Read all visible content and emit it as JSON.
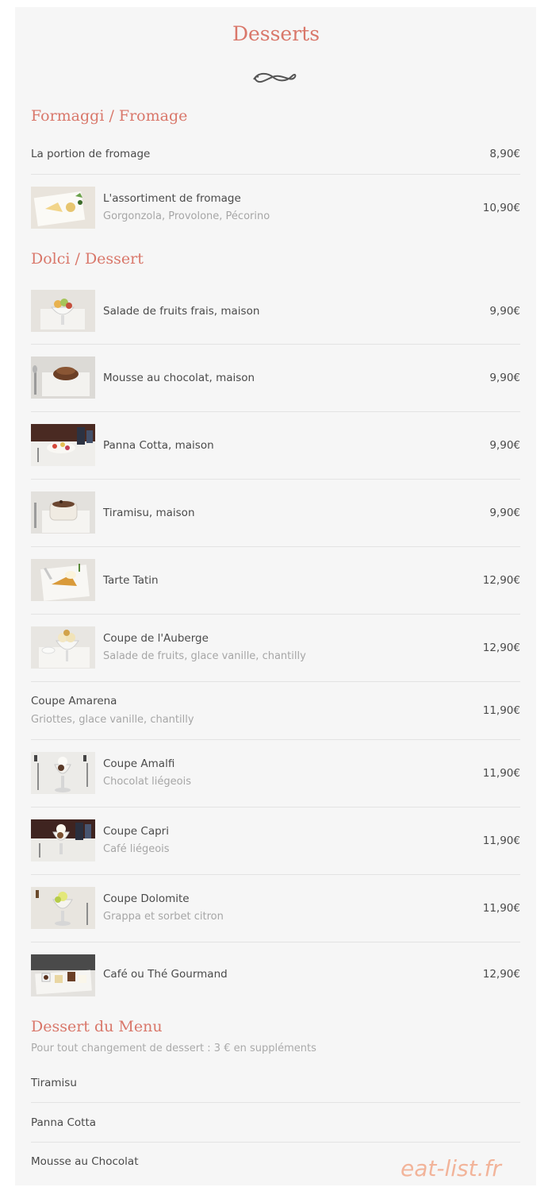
{
  "page": {
    "title": "Desserts"
  },
  "sections": {
    "fromage": {
      "title": "Formaggi / Fromage",
      "items": [
        {
          "name": "La portion de fromage",
          "price": "8,90€"
        },
        {
          "name": "L'assortiment de fromage",
          "desc": "Gorgonzola, Provolone, Pécorino",
          "price": "10,90€"
        }
      ]
    },
    "dessert": {
      "title": "Dolci / Dessert",
      "items": [
        {
          "name": "Salade de fruits frais, maison",
          "price": "9,90€"
        },
        {
          "name": "Mousse au chocolat, maison",
          "price": "9,90€"
        },
        {
          "name": "Panna Cotta, maison",
          "price": "9,90€"
        },
        {
          "name": "Tiramisu, maison",
          "price": "9,90€"
        },
        {
          "name": "Tarte Tatin",
          "price": "12,90€"
        },
        {
          "name": "Coupe de l'Auberge",
          "desc": "Salade de fruits, glace vanille, chantilly",
          "price": "12,90€"
        },
        {
          "name": "Coupe Amarena",
          "desc": "Griottes, glace vanille, chantilly",
          "price": "11,90€"
        },
        {
          "name": "Coupe Amalfi",
          "desc": "Chocolat liégeois",
          "price": "11,90€"
        },
        {
          "name": "Coupe Capri",
          "desc": "Café liégeois",
          "price": "11,90€"
        },
        {
          "name": "Coupe Dolomite",
          "desc": "Grappa et sorbet citron",
          "price": "11,90€"
        },
        {
          "name": "Café ou Thé Gourmand",
          "price": "12,90€"
        }
      ]
    },
    "menu": {
      "title": "Dessert du Menu",
      "note": "Pour tout changement de dessert : 3 € en suppléments",
      "items": [
        {
          "name": "Tiramisu"
        },
        {
          "name": "Panna Cotta"
        },
        {
          "name": "Mousse au Chocolat"
        }
      ]
    }
  },
  "watermark": "eat-list.fr",
  "colors": {
    "accent": "#d9776a",
    "panel": "#f6f6f6",
    "divider": "#e3e3e3"
  }
}
